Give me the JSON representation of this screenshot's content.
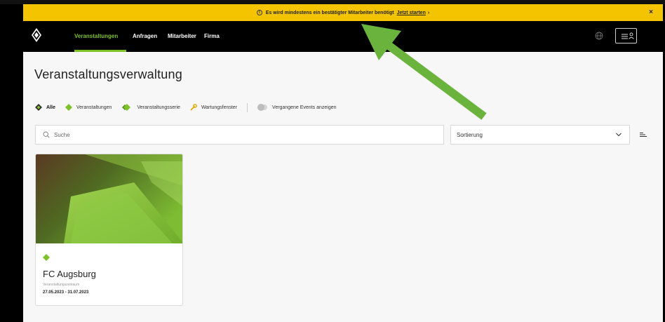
{
  "colors": {
    "banner": "#f5c400",
    "accent": "#7ec22a",
    "nav_bg": "#000000",
    "page_bg": "#f7f7f7",
    "arrow": "#6ab43e"
  },
  "banner": {
    "message": "Es wird mindestens ein bestätigter Mitarbeiter benötigt",
    "link": "Jetzt starten",
    "chevron": "›",
    "close": "×",
    "info_glyph": "i"
  },
  "nav": {
    "items": [
      {
        "label": "Veranstaltungen",
        "active": true
      },
      {
        "label": "Anfragen",
        "active": false
      },
      {
        "label": "Mitarbeiter",
        "active": false
      },
      {
        "label": "Firma",
        "active": false
      }
    ],
    "icons": [
      "club-logo-icon",
      "globe-icon",
      "menu-user-icon"
    ]
  },
  "page": {
    "title": "Veranstaltungsverwaltung",
    "filters": [
      {
        "label": "Alle",
        "icon": "diamond-icon",
        "active": true
      },
      {
        "label": "Veranstaltungen",
        "icon": "diamond-icon",
        "active": false
      },
      {
        "label": "Veranstaltungsserie",
        "icon": "stacked-diamond-icon",
        "active": false
      },
      {
        "label": "Wartungsfenster",
        "icon": "wrench-icon",
        "active": false
      }
    ],
    "past_events_toggle": {
      "label": "Vergangene Events anzeigen",
      "on": false
    },
    "search": {
      "placeholder": "Suche",
      "value": ""
    },
    "sort": {
      "label": "Sortierung"
    }
  },
  "events": [
    {
      "title": "FC Augsburg",
      "period_label": "Veranstaltungszeitraum",
      "dates": "27.05.2023 - 31.07.2023",
      "type_icon": "diamond-icon"
    }
  ]
}
